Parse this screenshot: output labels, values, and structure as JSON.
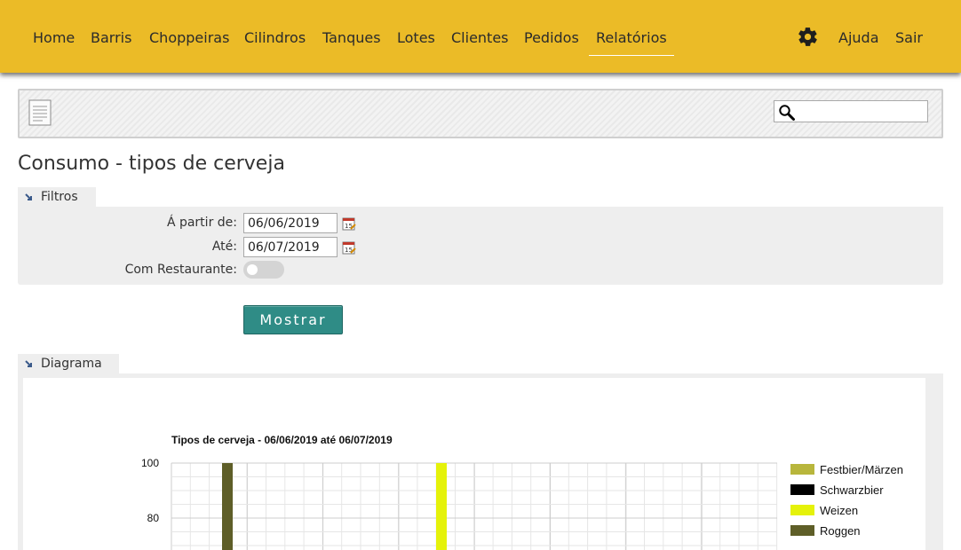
{
  "nav": {
    "items": [
      "Home",
      "Barris",
      "Choppeiras",
      "Cilindros",
      "Tanques",
      "Lotes",
      "Clientes",
      "Pedidos",
      "Relatórios"
    ],
    "active": "Relatórios",
    "help_label": "Ajuda",
    "logout_label": "Sair",
    "bar_color": "#ebbb27"
  },
  "page": {
    "title": "Consumo - tipos de cerveja"
  },
  "filters": {
    "section_label": "Filtros",
    "from_label": "Á partir de:",
    "from_value": "06/06/2019",
    "to_label": "Até:",
    "to_value": "06/07/2019",
    "restaurant_label": "Com Restaurante:",
    "restaurant_on": false,
    "show_button": "Mostrar",
    "button_color": "#2f8c86"
  },
  "diagram": {
    "section_label": "Diagrama"
  },
  "chart_data": {
    "type": "bar",
    "title": "Tipos de cerveja - 06/06/2019 até 06/07/2019",
    "ylim": [
      0,
      100
    ],
    "y_ticks": [
      80,
      100
    ],
    "grid": true,
    "legend_position": "right",
    "series": [
      {
        "name": "Festbier/Märzen",
        "color": "#b8b63c",
        "value": null
      },
      {
        "name": "Schwarzbier",
        "color": "#000000",
        "value": null
      },
      {
        "name": "Weizen",
        "color": "#e5f20a",
        "value": 100
      },
      {
        "name": "Roggen",
        "color": "#5e5e28",
        "value": 100
      }
    ]
  }
}
